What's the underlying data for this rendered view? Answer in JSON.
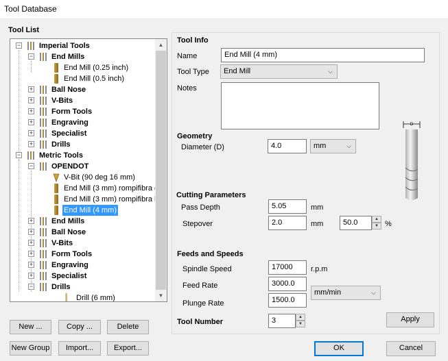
{
  "window": {
    "title": "Tool Database"
  },
  "tree_section": {
    "label": "Tool List"
  },
  "tree": {
    "imperial": {
      "label": "Imperial Tools",
      "end_mills": "End Mills",
      "em1": "End Mill (0.25 inch)",
      "em2": "End Mill (0.5 inch)",
      "ball_nose": "Ball Nose",
      "vbits": "V-Bits",
      "form": "Form Tools",
      "engraving": "Engraving",
      "specialist": "Specialist",
      "drills": "Drills"
    },
    "metric": {
      "label": "Metric Tools",
      "opendot": "OPENDOT",
      "od1": "V-Bit (90 deg 16 mm)",
      "od2": "End Mill (3 mm) rompifibra c",
      "od3": "End Mill (3 mm) rompifibra le",
      "od4": "End Mill (4 mm)",
      "end_mills": "End Mills",
      "ball_nose": "Ball Nose",
      "vbits": "V-Bits",
      "form": "Form Tools",
      "engraving": "Engraving",
      "specialist": "Specialist",
      "drills": "Drills",
      "drill1": "Drill (6 mm)"
    }
  },
  "buttons": {
    "new": "New ...",
    "copy": "Copy ...",
    "delete": "Delete",
    "new_group": "New Group",
    "import": "Import...",
    "export": "Export...",
    "apply": "Apply",
    "ok": "OK",
    "cancel": "Cancel"
  },
  "tool_info": {
    "heading": "Tool Info",
    "name_label": "Name",
    "name_value": "End Mill (4 mm)",
    "type_label": "Tool Type",
    "type_value": "End Mill",
    "notes_label": "Notes"
  },
  "geometry": {
    "heading": "Geometry",
    "diameter_label": "Diameter (D)",
    "diameter_value": "4.0",
    "units_value": "mm",
    "diagram_label": "D"
  },
  "cutting": {
    "heading": "Cutting Parameters",
    "pass_depth_label": "Pass Depth",
    "pass_depth_value": "5.05",
    "pass_depth_unit": "mm",
    "stepover_label": "Stepover",
    "stepover_value": "2.0",
    "stepover_unit": "mm",
    "stepover_pct_value": "50.0",
    "stepover_pct_unit": "%"
  },
  "feeds": {
    "heading": "Feeds and Speeds",
    "spindle_label": "Spindle Speed",
    "spindle_value": "17000",
    "spindle_unit": "r.p.m",
    "feed_label": "Feed Rate",
    "feed_value": "3000.0",
    "plunge_label": "Plunge Rate",
    "plunge_value": "1500.0",
    "rate_units_value": "mm/min"
  },
  "tool_number": {
    "label": "Tool Number",
    "value": "3"
  },
  "colors": {
    "selection": "#3399ff",
    "focus_border": "#0078d7",
    "tool_icon": "#c9a13d"
  }
}
